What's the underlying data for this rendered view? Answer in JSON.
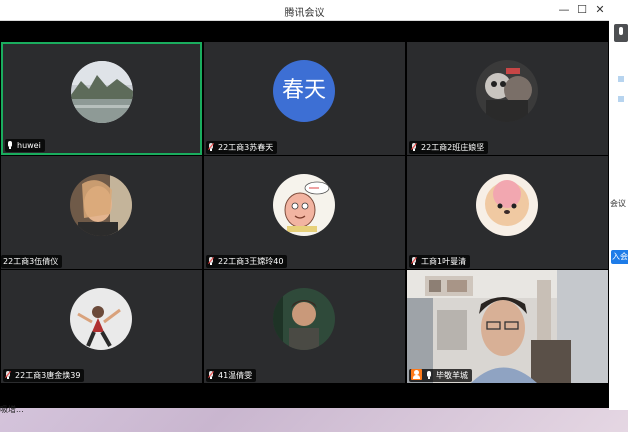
{
  "window": {
    "title": "腾讯会议"
  },
  "participants": [
    {
      "name": "huwei",
      "muted": false
    },
    {
      "name": "22工商3苏春天",
      "muted": true,
      "avatar_text": "春天"
    },
    {
      "name": "22工商2班庄娘坚",
      "muted": true
    },
    {
      "name": "22工商3伍倩仪",
      "muted": false
    },
    {
      "name": "22工商3王嫦玲40",
      "muted": true
    },
    {
      "name": "工商1叶曼清",
      "muted": true
    },
    {
      "name": "22工商3唐金焕39",
      "muted": true
    },
    {
      "name": "41温倩雯",
      "muted": true
    },
    {
      "name": "毕敬羊城",
      "muted": false
    }
  ],
  "background": {
    "side_text": "会议",
    "side_button": "入会",
    "taskbar_text": "吸增..."
  },
  "colors": {
    "active_speaker_border": "#1aad5e",
    "avatar_text_bg": "#3d6fd4",
    "host_badge": "#ff7a1a"
  }
}
